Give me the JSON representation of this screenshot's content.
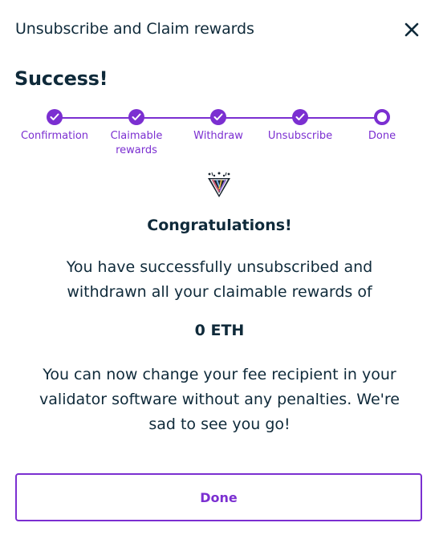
{
  "modal": {
    "title": "Unsubscribe and Claim rewards",
    "close_icon": "close-icon",
    "heading": "Success!"
  },
  "stepper": {
    "steps": [
      {
        "label": "Confirmation",
        "state": "completed",
        "icon": "check-icon"
      },
      {
        "label": "Claimable rewards",
        "state": "completed",
        "icon": "check-icon"
      },
      {
        "label": "Withdraw",
        "state": "completed",
        "icon": "check-icon"
      },
      {
        "label": "Unsubscribe",
        "state": "completed",
        "icon": "check-icon"
      },
      {
        "label": "Done",
        "state": "current",
        "icon": "ring-icon"
      }
    ]
  },
  "result": {
    "icon": "party-popper-icon",
    "congrats": "Congratulations!",
    "message": "You have successfully unsubscribed and withdrawn all your claimable rewards of",
    "amount": "0 ETH",
    "note": "You can now change your fee recipient in your validator software without any penalties. We're sad to see you go!"
  },
  "actions": {
    "done_label": "Done"
  },
  "colors": {
    "accent": "#7b2fd1",
    "text": "#0f2a3a",
    "background": "#ffffff"
  }
}
